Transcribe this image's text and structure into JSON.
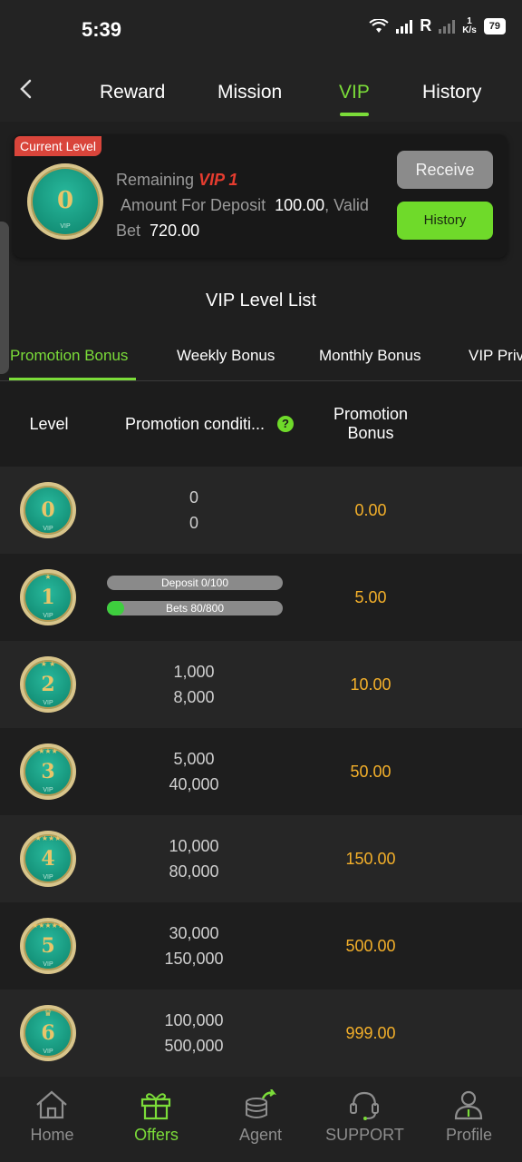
{
  "status": {
    "time": "5:39",
    "carrier": "R",
    "speed_top": "1",
    "speed_unit": "K/s",
    "battery": "79"
  },
  "nav": {
    "tabs": [
      {
        "label": "Reward"
      },
      {
        "label": "Mission"
      },
      {
        "label": "VIP"
      },
      {
        "label": "History"
      }
    ],
    "active": "VIP"
  },
  "current": {
    "badge": "Current Level",
    "medal_level": "0",
    "remaining_label": "Remaining",
    "target_vip": "VIP 1",
    "deposit_label": "Amount For Deposit",
    "deposit_value": "100.00",
    "valid_label": ", Valid",
    "bet_label": "Bet",
    "bet_value": "720.00",
    "receive_label": "Receive",
    "history_label": "History"
  },
  "list_title": "VIP Level List",
  "subtabs": [
    {
      "label": "Promotion Bonus"
    },
    {
      "label": "Weekly Bonus"
    },
    {
      "label": "Monthly Bonus"
    },
    {
      "label": "VIP Priv"
    }
  ],
  "table": {
    "headers": {
      "level": "Level",
      "condition": "Promotion conditi...",
      "bonus": "Promotion Bonus"
    },
    "rows": [
      {
        "level": "0",
        "deposit": "0",
        "bet": "0",
        "bonus": "0.00"
      },
      {
        "level": "1",
        "deposit_text": "Deposit 0/100",
        "bet_text": "Bets 80/800",
        "deposit_progress": 0.0,
        "bet_progress": 0.1,
        "bonus": "5.00"
      },
      {
        "level": "2",
        "deposit": "1,000",
        "bet": "8,000",
        "bonus": "10.00"
      },
      {
        "level": "3",
        "deposit": "5,000",
        "bet": "40,000",
        "bonus": "50.00"
      },
      {
        "level": "4",
        "deposit": "10,000",
        "bet": "80,000",
        "bonus": "150.00"
      },
      {
        "level": "5",
        "deposit": "30,000",
        "bet": "150,000",
        "bonus": "500.00"
      },
      {
        "level": "6",
        "deposit": "100,000",
        "bet": "500,000",
        "bonus": "999.00"
      }
    ]
  },
  "bottom_nav": [
    {
      "label": "Home",
      "icon": "home-icon"
    },
    {
      "label": "Offers",
      "icon": "gift-icon"
    },
    {
      "label": "Agent",
      "icon": "coins-share-icon"
    },
    {
      "label": "SUPPORT",
      "icon": "headset-icon"
    },
    {
      "label": "Profile",
      "icon": "profile-icon"
    }
  ],
  "colors": {
    "accent": "#7bdc39",
    "bonus": "#f4b02a",
    "vip_red": "#e53c2f"
  }
}
